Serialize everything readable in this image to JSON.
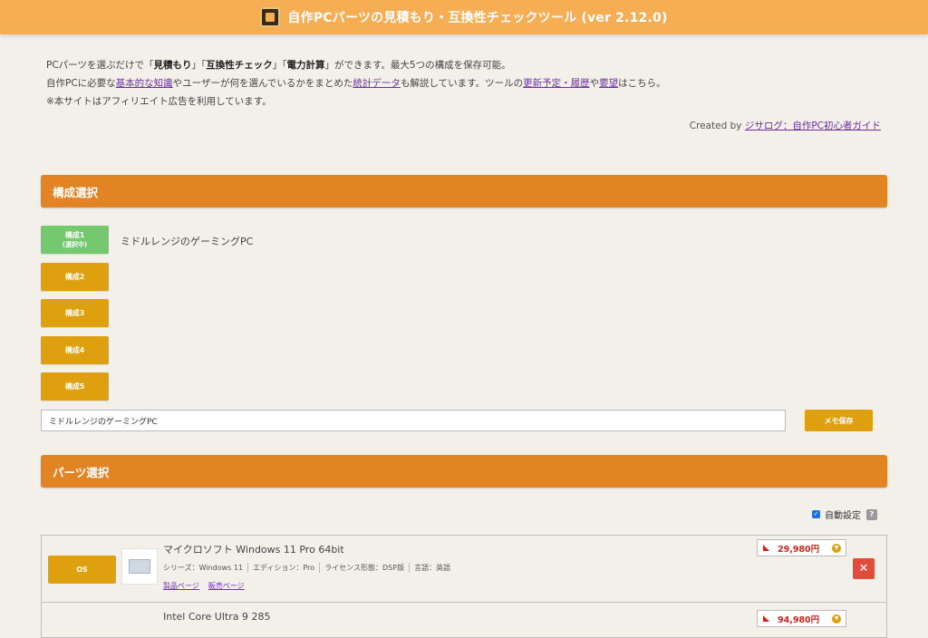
{
  "header": {
    "title": "自作PCパーツの見積もり・互換性チェックツール (ver 2.12.0)"
  },
  "intro": {
    "line1_a": "PCパーツを選ぶだけで「",
    "line1_b1": "見積もり",
    "line1_c": "」「",
    "line1_b2": "互換性チェック",
    "line1_d": "」「",
    "line1_b3": "電力計算",
    "line1_e": "」ができます。最大5つの構成を保存可能。",
    "line2_a": "自作PCに必要な",
    "line2_link1": "基本的な知識",
    "line2_b": "やユーザーが何を選んでいるかをまとめた",
    "line2_link2": "統計データ",
    "line2_c": "も解説しています。ツールの",
    "line2_link3": "更新予定・履歴",
    "line2_d": "や",
    "line2_link4": "要望",
    "line2_e": "はこちら。",
    "line3": "※本サイトはアフィリエイト広告を利用しています。"
  },
  "credit": {
    "prefix": "Created by ",
    "link": "ジサログ：自作PC初心者ガイド"
  },
  "config_section": {
    "title": "構成選択",
    "buttons": [
      {
        "label": "構成1",
        "sub": "(選択中)"
      },
      {
        "label": "構成2"
      },
      {
        "label": "構成3"
      },
      {
        "label": "構成4"
      },
      {
        "label": "構成5"
      }
    ],
    "active_name": "ミドルレンジのゲーミングPC",
    "memo_value": "ミドルレンジのゲーミングPC",
    "memo_save_label": "メモ保存"
  },
  "parts_section": {
    "title": "パーツ選択",
    "auto_setting_label": "自動設定",
    "help": "?",
    "rows": [
      {
        "category": "OS",
        "name": "マイクロソフト Windows 11 Pro 64bit",
        "specs": [
          "シリーズ：Windows 11",
          "エディション：Pro",
          "ライセンス形態：DSP版",
          "言語：英語"
        ],
        "links": [
          "製品ページ",
          "販売ページ"
        ],
        "price": "29,980円"
      },
      {
        "category": "",
        "name": "Intel Core Ultra 9 285",
        "price": "94,980円"
      }
    ]
  },
  "colors": {
    "header_bg": "#f5ae54",
    "section_bar": "#e38424",
    "button_gold": "#dea00e",
    "button_active_green": "#74c96f",
    "price_red": "#d0261b",
    "delete_red": "#e04b3c"
  }
}
